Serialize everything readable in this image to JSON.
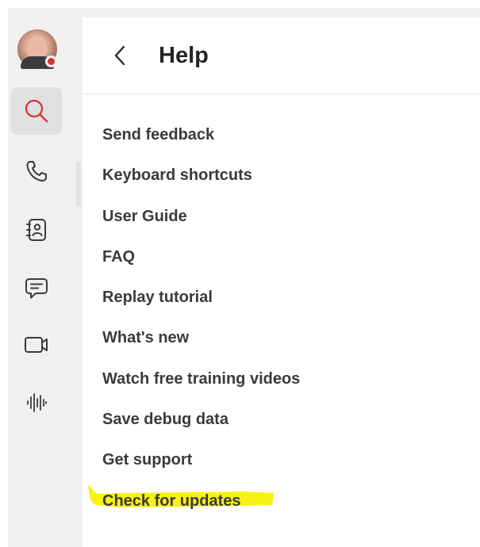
{
  "rail": {
    "avatar": {
      "status_color": "#d13438"
    },
    "items": [
      {
        "id": "search",
        "icon": "search-icon",
        "active": true,
        "accent": "#d13438"
      },
      {
        "id": "calls",
        "icon": "phone-icon",
        "active": false
      },
      {
        "id": "contacts",
        "icon": "contact-book-icon",
        "active": false
      },
      {
        "id": "chat",
        "icon": "chat-icon",
        "active": false
      },
      {
        "id": "meetings",
        "icon": "video-camera-icon",
        "active": false
      },
      {
        "id": "voicemail",
        "icon": "audio-waveform-icon",
        "active": false
      }
    ]
  },
  "header": {
    "back_icon": "chevron-left-icon",
    "title": "Help"
  },
  "menu": {
    "items": [
      {
        "label": "Send feedback"
      },
      {
        "label": "Keyboard shortcuts"
      },
      {
        "label": "User Guide"
      },
      {
        "label": "FAQ"
      },
      {
        "label": "Replay tutorial"
      },
      {
        "label": "What's new"
      },
      {
        "label": "Watch free training videos"
      },
      {
        "label": "Save debug data"
      },
      {
        "label": "Get support"
      },
      {
        "label": "Check for updates",
        "highlighted": true,
        "highlight_color": "#f7f100"
      }
    ]
  }
}
